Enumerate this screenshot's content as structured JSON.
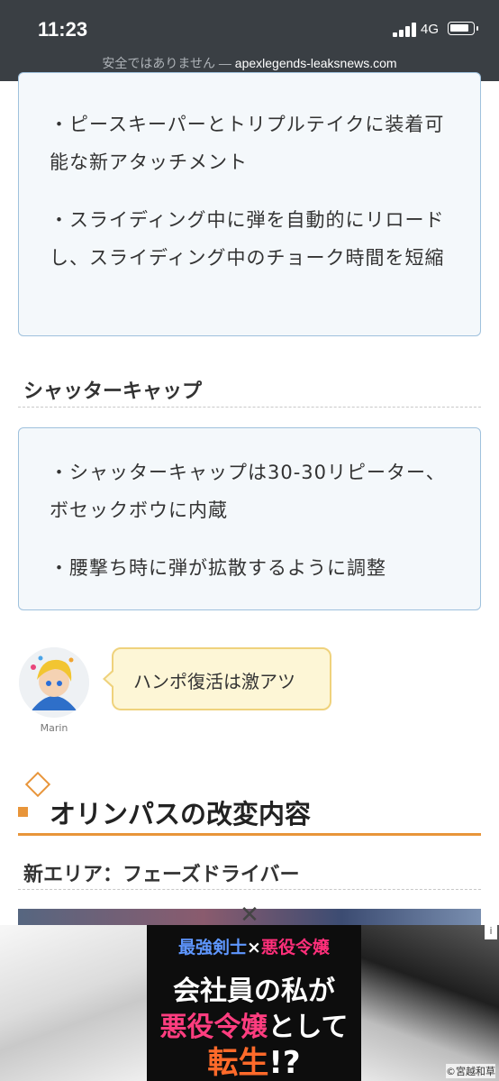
{
  "status": {
    "time": "11:23",
    "network": "4G"
  },
  "address_bar": {
    "warning": "安全ではありません —",
    "domain": "apexlegends-leaksnews.com"
  },
  "box1": {
    "items": [
      "・ピースキーパーとトリプルテイクに装着可能な新アタッチメント",
      "・スライディング中に弾を自動的にリロードし、スライディング中のチョーク時間を短縮"
    ]
  },
  "section_shattercap": {
    "heading": "シャッターキャップ"
  },
  "box2": {
    "items": [
      "・シャッターキャップは30-30リピーター、ボセックボウに内蔵",
      "・腰撃ち時に弾が拡散するように調整"
    ]
  },
  "comment": {
    "avatar_name": "Marin",
    "text": "ハンポ復活は激アツ"
  },
  "section_olympus": {
    "heading": "オリンパスの改変内容",
    "subheading": "新エリア：フェーズドライバー"
  },
  "ad": {
    "line1_a": "最強剣士",
    "line1_x": "×",
    "line1_b": "悪役令嬢",
    "line2": "会社員の私が",
    "line3_a": "悪役令嬢",
    "line3_b": "として",
    "line4_a": "転生",
    "line4_b": "!?",
    "copyright": "©宮越和草",
    "info": "i",
    "close": "✕"
  }
}
